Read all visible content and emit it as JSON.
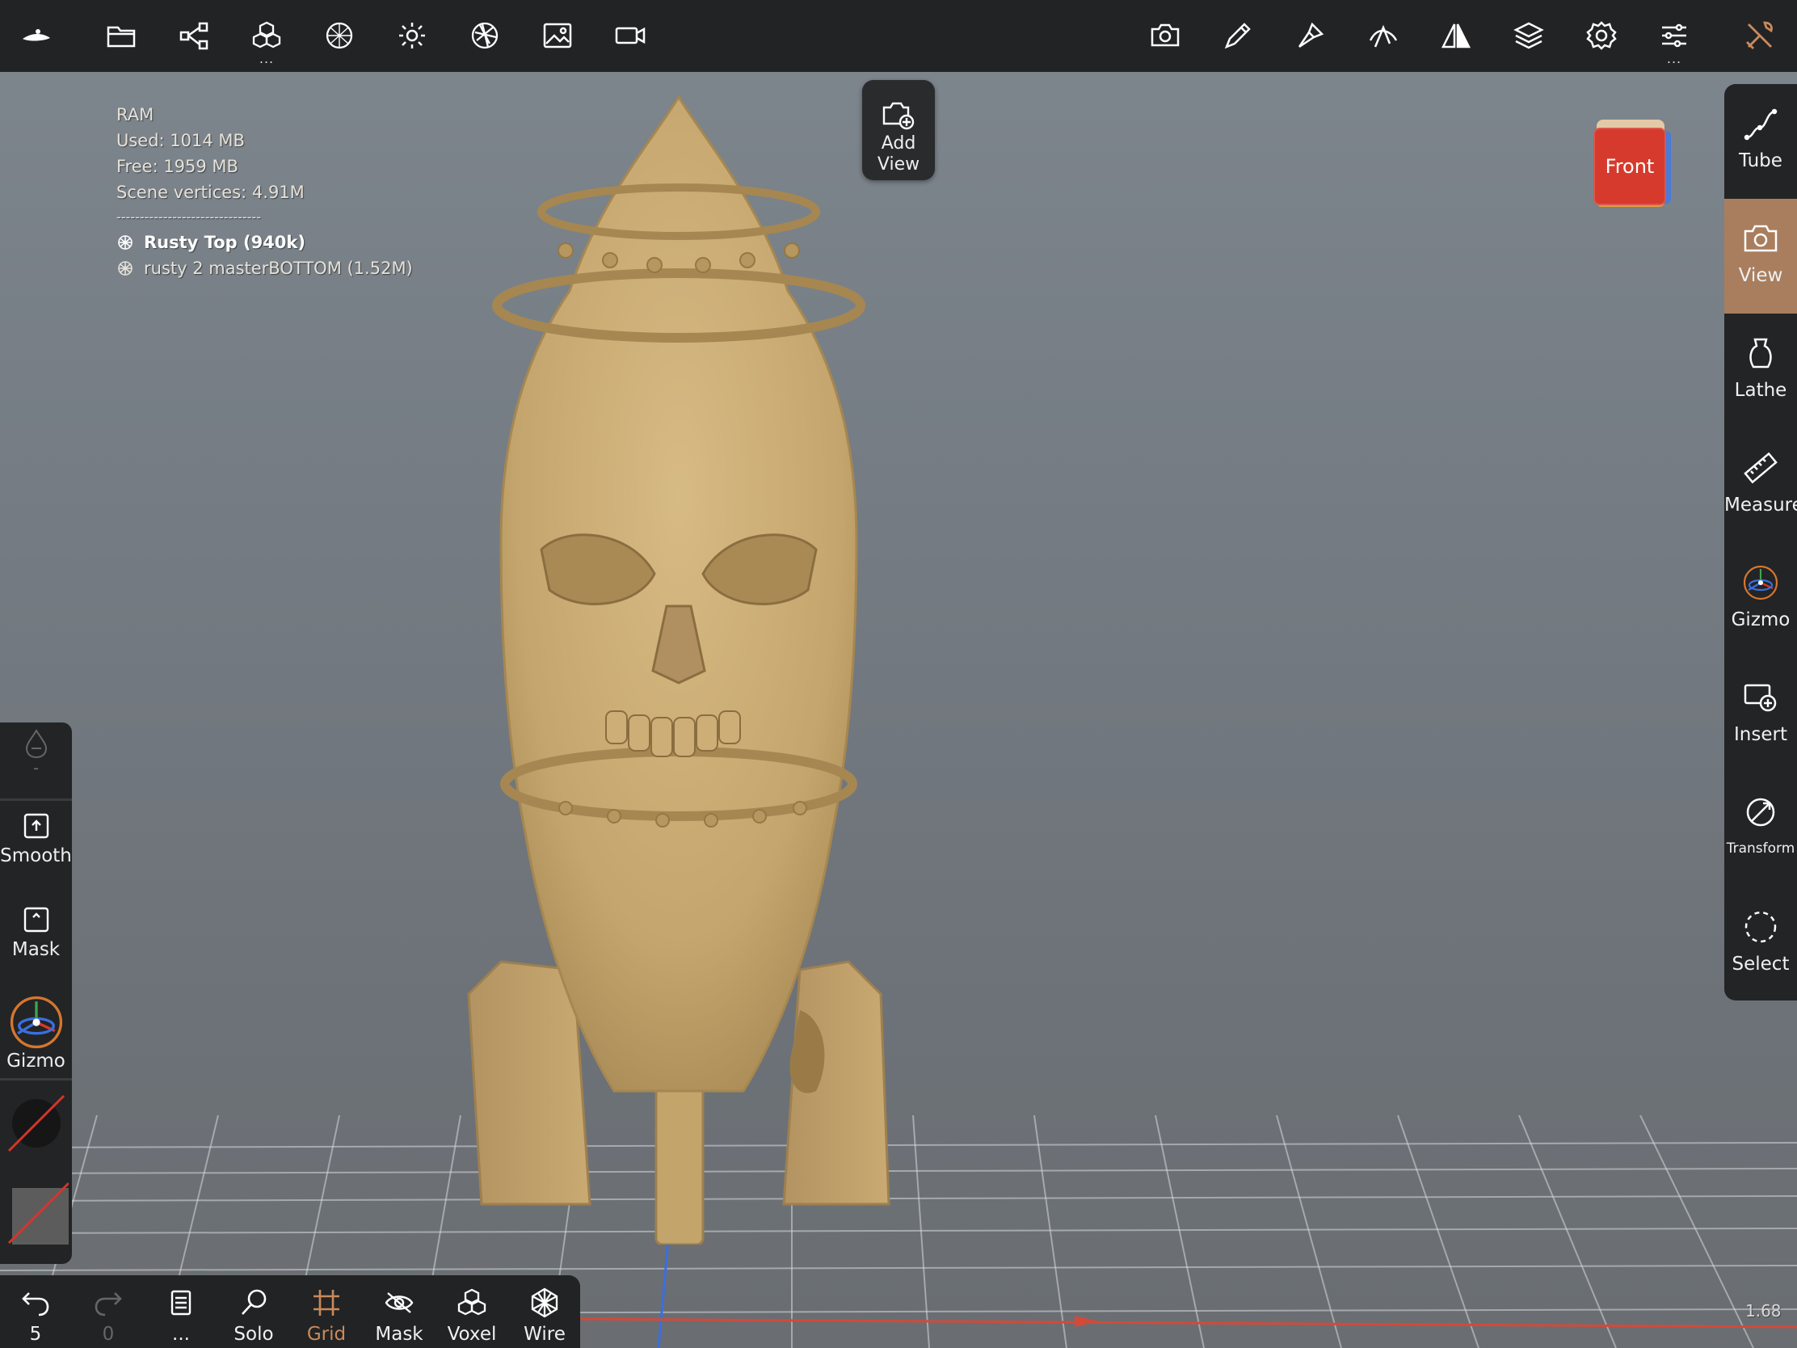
{
  "info": {
    "ram_label": "RAM",
    "used": "Used: 1014 MB",
    "free": "Free: 1959 MB",
    "vertices": "Scene vertices: 4.91M",
    "separator": "-------------------------------",
    "meshes": [
      {
        "label": "Rusty Top (940k)",
        "active": true
      },
      {
        "label": "rusty 2 masterBOTTOM (1.52M)",
        "active": false
      }
    ]
  },
  "add_view": {
    "line1": "Add",
    "line2": "View"
  },
  "cube": {
    "label": "Front"
  },
  "top_toolbar": {
    "more_dots": "...",
    "icons": [
      "app-logo-icon",
      "folder-icon",
      "scene-tree-icon",
      "primitive-cubes-icon",
      "material-sphere-icon",
      "sun-icon",
      "aperture-icon",
      "image-icon",
      "video-camera-icon",
      "camera-icon",
      "pen-icon",
      "brush-icon",
      "stroke-icon",
      "mirror-icon",
      "layers-icon",
      "settings-gear-icon",
      "sliders-icon",
      "tools-icon"
    ]
  },
  "right_panel": {
    "items": [
      {
        "label": "Tube",
        "icon": "tube-curve-icon",
        "active": false
      },
      {
        "label": "View",
        "icon": "camera-icon",
        "active": true
      },
      {
        "label": "Lathe",
        "icon": "vase-icon",
        "active": false
      },
      {
        "label": "Measure",
        "icon": "ruler-icon",
        "active": false
      },
      {
        "label": "Gizmo",
        "icon": "gizmo-icon",
        "active": false
      },
      {
        "label": "Insert",
        "icon": "insert-icon",
        "active": false
      },
      {
        "label": "Transform",
        "icon": "transform-icon",
        "active": false
      },
      {
        "label": "Select",
        "icon": "dashed-circle-icon",
        "active": false
      }
    ]
  },
  "left_panel": {
    "top_value": "-",
    "items": [
      {
        "label": "Smooth",
        "icon": "smooth-icon"
      },
      {
        "label": "Mask",
        "icon": "mask-icon"
      },
      {
        "label": "Gizmo",
        "icon": "gizmo-icon"
      }
    ]
  },
  "bottom_bar": {
    "undo_count": "5",
    "redo_count": "0",
    "more": "...",
    "items": [
      {
        "label": "Solo",
        "icon": "search-icon"
      },
      {
        "label": "Grid",
        "icon": "grid-icon"
      },
      {
        "label": "Mask",
        "icon": "eye-slash-icon"
      },
      {
        "label": "Voxel",
        "icon": "voxel-icon"
      },
      {
        "label": "Wire",
        "icon": "wireframe-icon"
      }
    ]
  },
  "zoom": "1.68",
  "colors": {
    "accent": "#a97e5e",
    "grid_accent": "#c98a5c",
    "model": "#c7a86f",
    "panel": "#232425",
    "cube_front": "#d63a2c"
  }
}
